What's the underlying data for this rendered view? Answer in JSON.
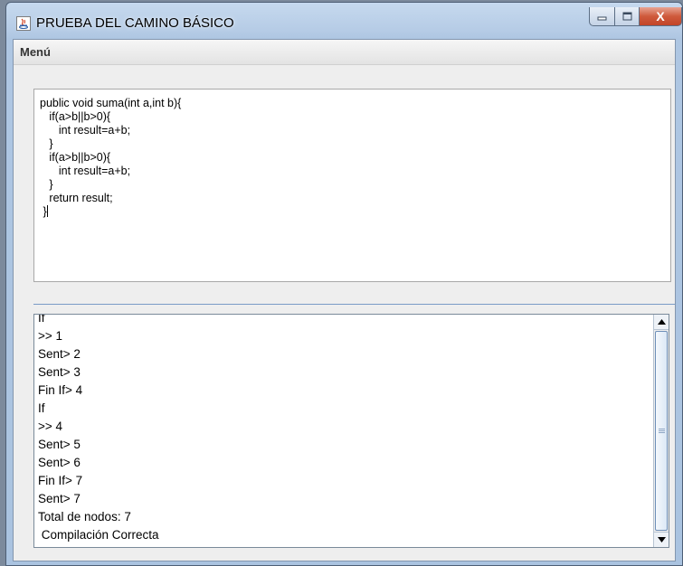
{
  "window": {
    "title": "PRUEBA DEL CAMINO BÁSICO",
    "close_glyph": "X"
  },
  "menubar": {
    "items": [
      {
        "label": "Menú"
      }
    ]
  },
  "editor": {
    "lines": [
      "public void suma(int a,int b){",
      "   if(a>b||b>0){",
      "      int result=a+b;",
      "   }",
      "   if(a>b||b>0){",
      "      int result=a+b;",
      "   }",
      "   return result;",
      " }"
    ]
  },
  "output": {
    "lines": [
      "If",
      ">> 1",
      "Sent> 2",
      "Sent> 3",
      "Fin If> 4",
      "If",
      ">> 4",
      "Sent> 5",
      "Sent> 6",
      "Fin If> 7",
      "Sent> 7",
      "Total de nodos: 7",
      " Compilación Correcta"
    ]
  },
  "icons": {
    "app": "java-app-icon",
    "minimize": "minimize-icon",
    "maximize": "maximize-icon",
    "close": "close-icon",
    "scroll_up": "scroll-up-arrow-icon",
    "scroll_down": "scroll-down-arrow-icon"
  },
  "colors": {
    "close_button": "#c9472b",
    "separator": "#7a9bc6"
  }
}
